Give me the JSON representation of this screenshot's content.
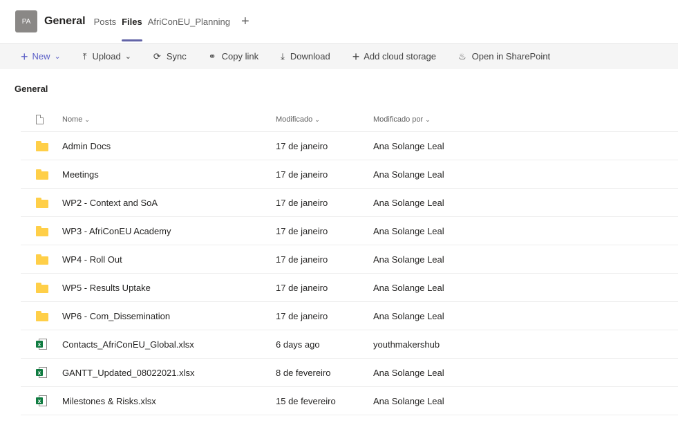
{
  "header": {
    "avatar_initials": "PA",
    "channel_name": "General",
    "tabs": [
      {
        "label": "Posts",
        "active": false
      },
      {
        "label": "Files",
        "active": true
      },
      {
        "label": "AfriConEU_Planning",
        "active": false
      }
    ],
    "add_tab_symbol": "+"
  },
  "toolbar": {
    "new_label": "New",
    "upload_label": "Upload",
    "sync_label": "Sync",
    "copy_link_label": "Copy link",
    "download_label": "Download",
    "add_cloud_label": "Add cloud storage",
    "sharepoint_label": "Open in SharePoint"
  },
  "breadcrumb": {
    "current": "General"
  },
  "columns": {
    "name": "Nome",
    "modified": "Modificado",
    "modified_by": "Modificado por"
  },
  "files": [
    {
      "type": "folder",
      "name": "Admin Docs",
      "modified": "17 de janeiro",
      "modified_by": "Ana Solange Leal"
    },
    {
      "type": "folder",
      "name": "Meetings",
      "modified": "17 de janeiro",
      "modified_by": "Ana Solange Leal"
    },
    {
      "type": "folder",
      "name": "WP2 - Context and SoA",
      "modified": "17 de janeiro",
      "modified_by": "Ana Solange Leal"
    },
    {
      "type": "folder",
      "name": "WP3 - AfriConEU Academy",
      "modified": "17 de janeiro",
      "modified_by": "Ana Solange Leal"
    },
    {
      "type": "folder",
      "name": "WP4 - Roll Out",
      "modified": "17 de janeiro",
      "modified_by": "Ana Solange Leal"
    },
    {
      "type": "folder",
      "name": "WP5 - Results Uptake",
      "modified": "17 de janeiro",
      "modified_by": "Ana Solange Leal"
    },
    {
      "type": "folder",
      "name": "WP6 - Com_Dissemination",
      "modified": "17 de janeiro",
      "modified_by": "Ana Solange Leal"
    },
    {
      "type": "xlsx",
      "name": "Contacts_AfriConEU_Global.xlsx",
      "modified": "6 days ago",
      "modified_by": "youthmakershub"
    },
    {
      "type": "xlsx",
      "name": "GANTT_Updated_08022021.xlsx",
      "modified": "8 de fevereiro",
      "modified_by": "Ana Solange Leal"
    },
    {
      "type": "xlsx",
      "name": "Milestones & Risks.xlsx",
      "modified": "15 de fevereiro",
      "modified_by": "Ana Solange Leal"
    }
  ],
  "colors": {
    "accent": "#6264a7",
    "new_button": "#5b5fc7",
    "folder": "#ffcf48",
    "excel": "#107c41"
  }
}
